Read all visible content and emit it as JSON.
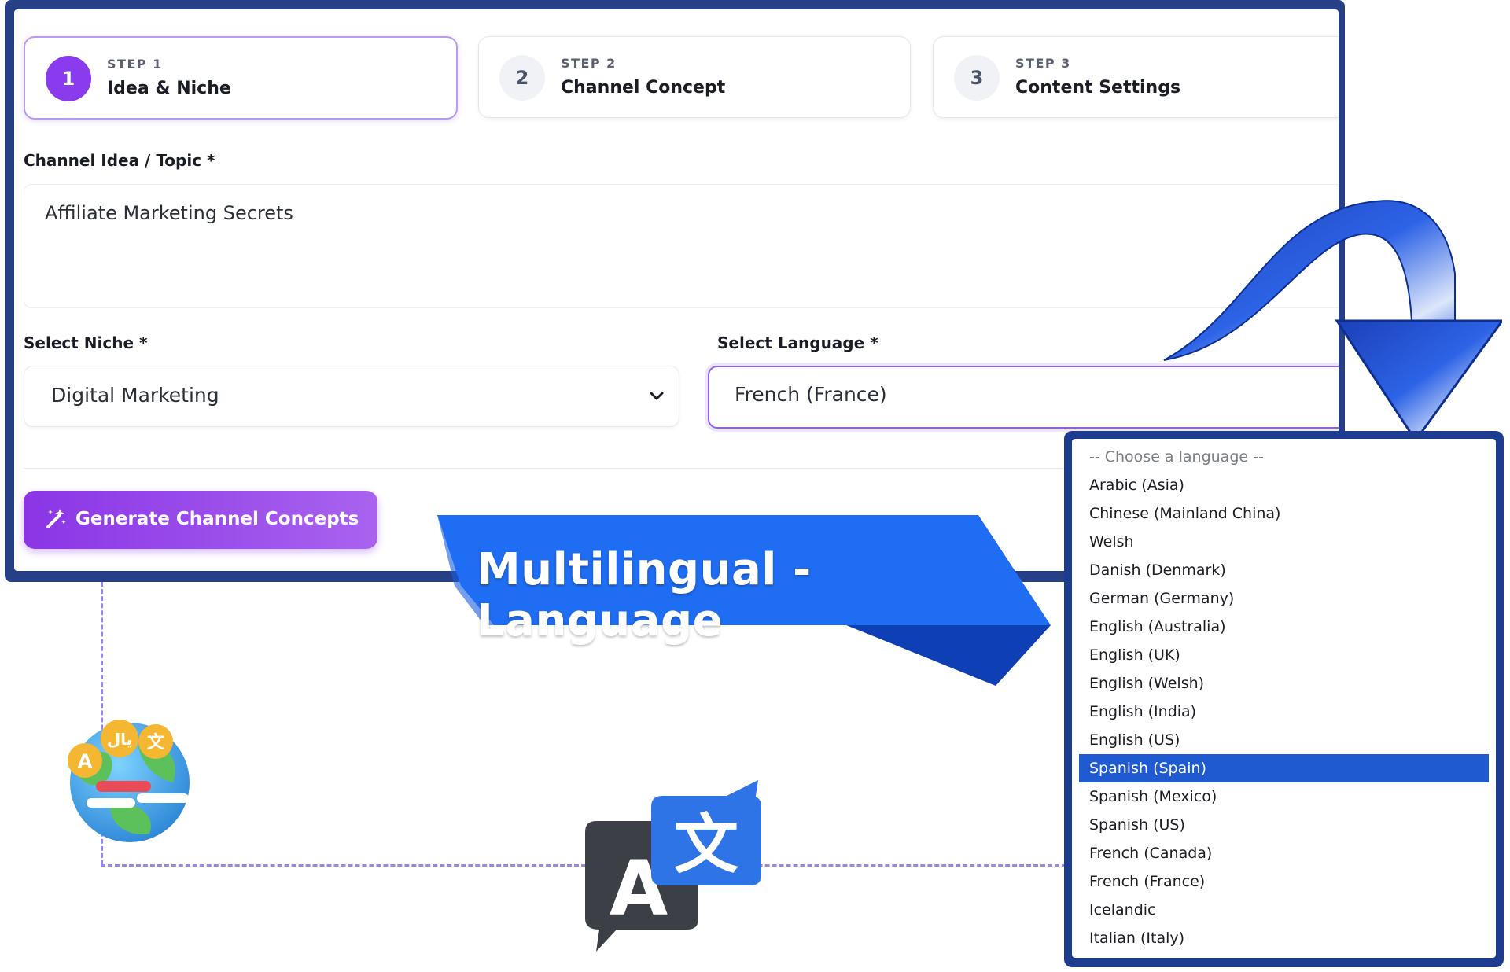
{
  "steps": [
    {
      "number": "1",
      "label": "STEP 1",
      "title": "Idea & Niche",
      "active": true
    },
    {
      "number": "2",
      "label": "STEP 2",
      "title": "Channel Concept",
      "active": false
    },
    {
      "number": "3",
      "label": "STEP 3",
      "title": "Content Settings",
      "active": false
    }
  ],
  "form": {
    "topic_label": "Channel Idea / Topic *",
    "topic_value": "Affiliate Marketing Secrets",
    "niche_label": "Select Niche *",
    "niche_value": "Digital Marketing",
    "language_label": "Select Language *",
    "language_value": "French (France)",
    "generate_label": "Generate Channel Concepts"
  },
  "banner": {
    "text": "Multilingual -Language"
  },
  "language_options": {
    "placeholder": "-- Choose a language --",
    "items": [
      "Arabic (Asia)",
      "Chinese (Mainland China)",
      "Welsh",
      "Danish (Denmark)",
      "German (Germany)",
      "English (Australia)",
      "English (UK)",
      "English (Welsh)",
      "English (India)",
      "English (US)",
      "Spanish (Spain)",
      "Spanish (Mexico)",
      "Spanish (US)",
      "French (Canada)",
      "French (France)",
      "Icelandic",
      "Italian (Italy)"
    ],
    "selected": "Spanish (Spain)"
  },
  "globe_icon": {
    "glyphs": [
      "A",
      "یال",
      "文"
    ]
  },
  "translate_icon": {
    "glyphs": [
      "A",
      "文"
    ]
  },
  "colors": {
    "window_frame": "#263f86",
    "accent_purple": "#8b3bee",
    "banner_blue": "#1f6df2",
    "selected_blue": "#1f5ad1",
    "dashed_line": "#9a86e8"
  }
}
